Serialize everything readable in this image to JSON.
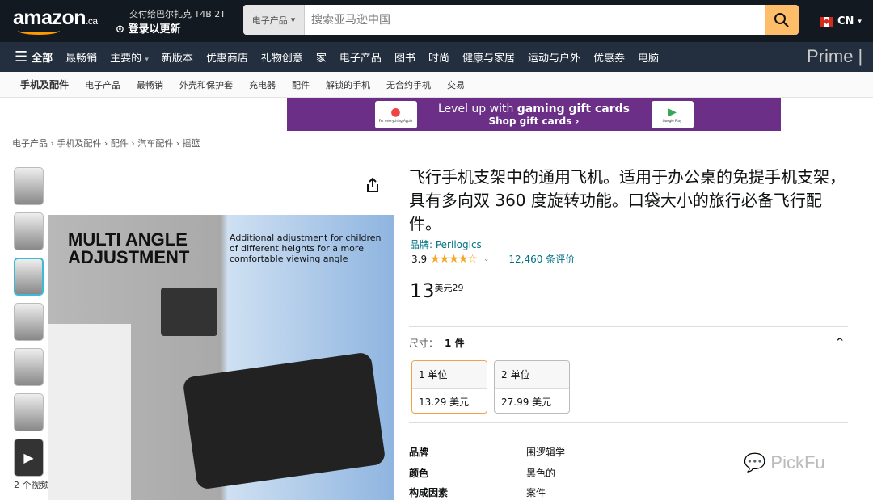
{
  "header": {
    "logo": "amazon",
    "logo_suffix": ".ca",
    "deliver_to": "交付给巴尔扎克 T4B 2T",
    "login_update": "登录以更新",
    "search_category": "电子产品",
    "search_placeholder": "搜索亚马逊中国",
    "locale": "CN"
  },
  "nav": {
    "all": "全部",
    "items": [
      "最畅销",
      "主要的",
      "新版本",
      "优惠商店",
      "礼物创意",
      "家",
      "电子产品",
      "图书",
      "时尚",
      "健康与家居",
      "运动与户外",
      "优惠券",
      "电脑"
    ],
    "prime": "Prime |"
  },
  "subnav": [
    "手机及配件",
    "电子产品",
    "最畅销",
    "外壳和保护套",
    "充电器",
    "配件",
    "解锁的手机",
    "无合约手机",
    "交易"
  ],
  "banner": {
    "line1_a": "Level up with ",
    "line1_b": "gaming gift cards",
    "line2": "Shop gift cards ›",
    "card_left": "For everything Apple",
    "card_right": "Google Play"
  },
  "breadcrumb": [
    "电子产品",
    "手机及配件",
    "配件",
    "汽车配件",
    "摇篮"
  ],
  "gallery": {
    "videos": "2 个视频",
    "image_heading": "MULTI ANGLE ADJUSTMENT",
    "image_sub": "Additional adjustment for children of different heights for a more comfortable viewing angle"
  },
  "product": {
    "title": "飞行手机支架中的通用飞机。适用于办公桌的免提手机支架，具有多向双 360 度旋转功能。口袋大小的旅行必备飞行配件。",
    "brand": "品牌: Perilogics",
    "rating": "3.9",
    "stars": 3.9,
    "reviews": "12,460 条评价",
    "price_whole": "13",
    "price_frac": "美元29"
  },
  "size": {
    "label": "尺寸：",
    "selected": "1 件",
    "options": [
      {
        "name": "1 单位",
        "price": "13.29 美元"
      },
      {
        "name": "2 单位",
        "price": "27.99 美元"
      }
    ]
  },
  "specs": [
    {
      "k": "品牌",
      "v": "围逻辑学"
    },
    {
      "k": "颜色",
      "v": "黑色的"
    },
    {
      "k": "构成因素",
      "v": "案件"
    }
  ],
  "watermark": "PickFu",
  "colors": {
    "header": "#131921",
    "nav": "#232f3e",
    "search_button": "#febd69",
    "link": "#007185",
    "star": "#f5a623",
    "banner": "#6b2f87"
  }
}
